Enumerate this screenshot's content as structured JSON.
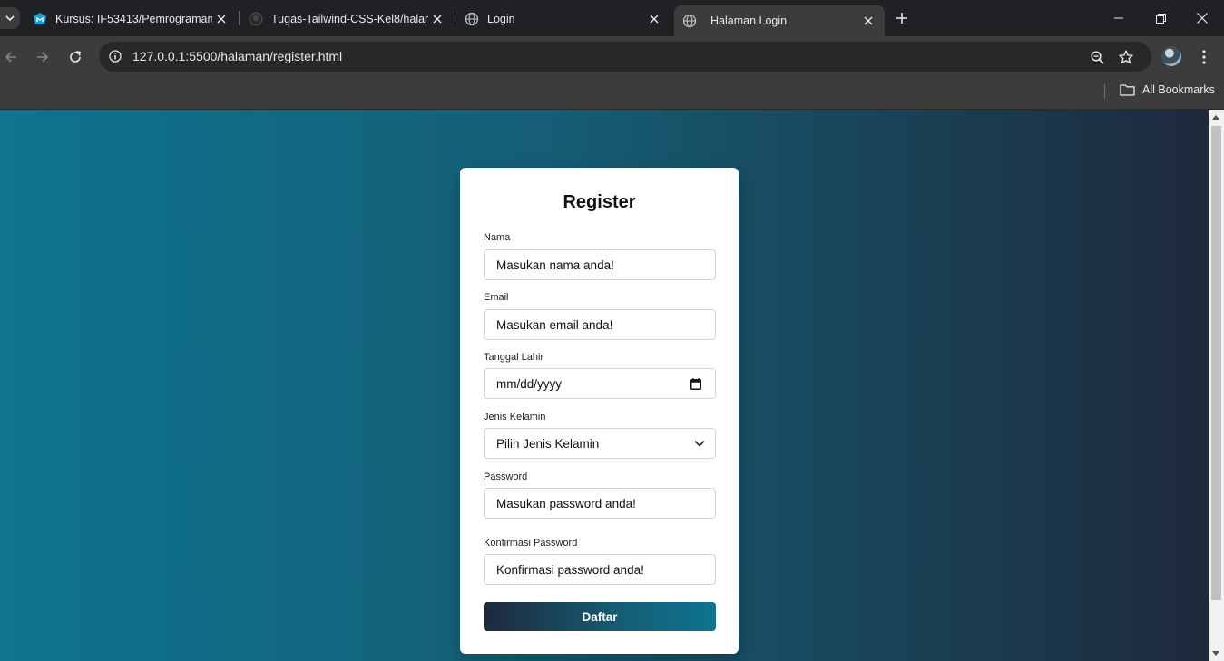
{
  "browser": {
    "tabs": [
      {
        "title": "Kursus: IF53413/Pemrograman W",
        "active": false
      },
      {
        "title": "Tugas-Tailwind-CSS-Kel8/halam",
        "active": false
      },
      {
        "title": "Login",
        "active": false
      },
      {
        "title": "Halaman Login",
        "active": true
      }
    ],
    "url": "127.0.0.1:5500/halaman/register.html",
    "bookmarks_label": "All Bookmarks"
  },
  "form": {
    "title": "Register",
    "fields": [
      {
        "label": "Nama",
        "placeholder": "Masukan nama anda!"
      },
      {
        "label": "Email",
        "placeholder": "Masukan email anda!"
      },
      {
        "label": "Tanggal Lahir",
        "placeholder": "mm/dd/yyyy"
      },
      {
        "label": "Jenis Kelamin",
        "placeholder": "Pilih Jenis Kelamin"
      },
      {
        "label": "Password",
        "placeholder": "Masukan password anda!"
      },
      {
        "label": "Konfirmasi Password",
        "placeholder": "Konfirmasi password anda!"
      }
    ],
    "submit_label": "Daftar"
  },
  "colors": {
    "gradient_start": "#0e7490",
    "gradient_end": "#1e293b"
  }
}
